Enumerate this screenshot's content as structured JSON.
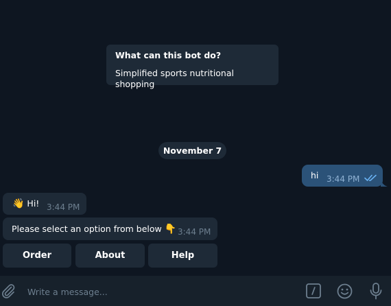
{
  "bot_info": {
    "title": "What can this bot do?",
    "description": "Simplified sports nutritional shopping"
  },
  "date_separator": "November 7",
  "messages": [
    {
      "direction": "out",
      "text": "hi",
      "time": "3:44 PM",
      "status": "read"
    },
    {
      "direction": "in",
      "emoji": "👋",
      "text": "Hi!",
      "time": "3:44 PM"
    },
    {
      "direction": "in",
      "text": "Please select an option from below",
      "emoji": "👇",
      "time": "3:44 PM"
    }
  ],
  "keyboard": {
    "buttons": [
      "Order",
      "About",
      "Help"
    ]
  },
  "composer": {
    "placeholder": "Write a message..."
  },
  "colors": {
    "background": "#0e1621",
    "bubble_in": "#1e2a37",
    "bubble_out": "#2b5278",
    "composer": "#17212b",
    "icon": "#6d7f8f",
    "read_ticks": "#6ab3f3"
  },
  "icons": {
    "attach": "paperclip-icon",
    "commands": "slash-command-icon",
    "emoji": "smile-icon",
    "voice": "microphone-icon",
    "read": "double-check-icon"
  }
}
